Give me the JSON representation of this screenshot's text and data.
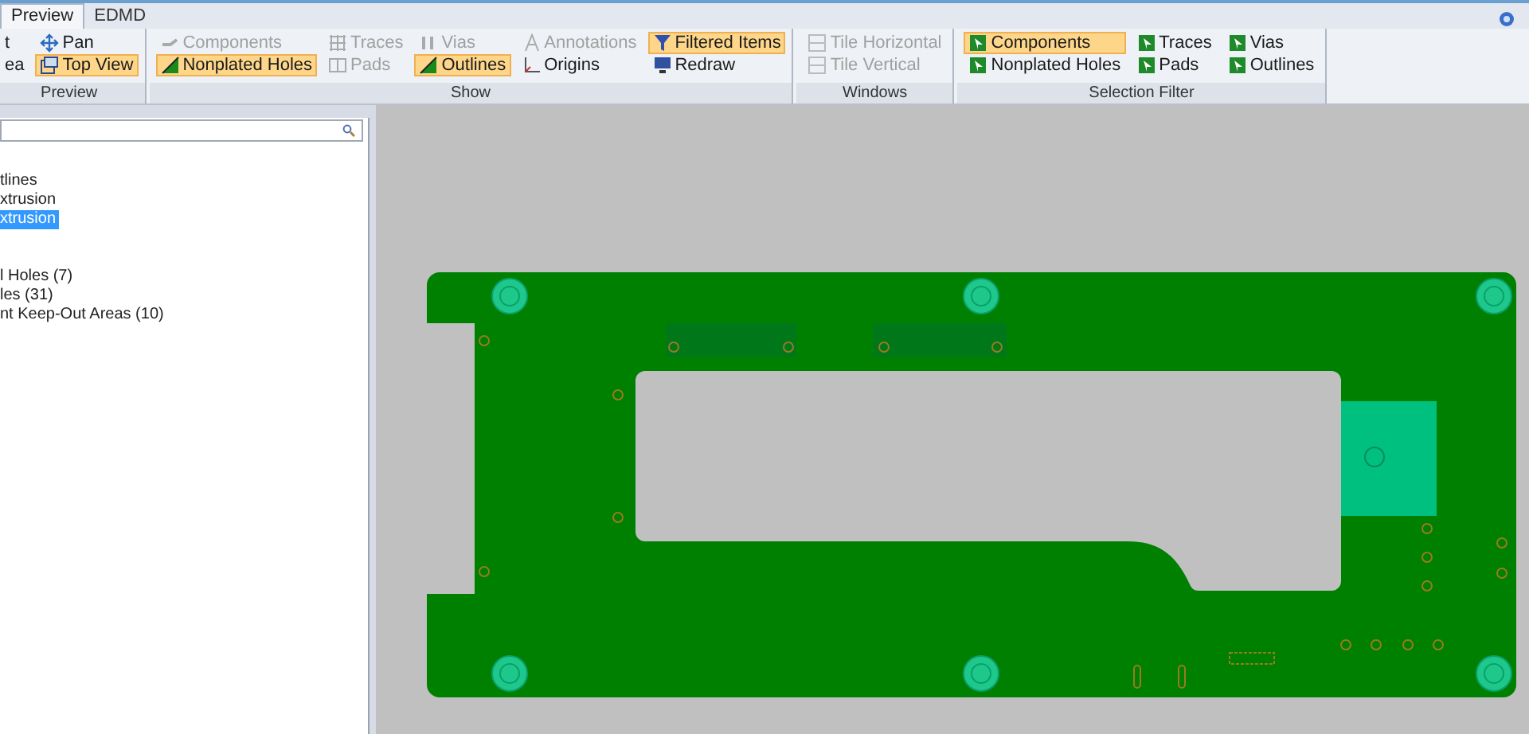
{
  "tabs": [
    {
      "label": "Preview",
      "selected": true
    },
    {
      "label": "EDMD",
      "selected": false
    }
  ],
  "ribbon": [
    {
      "label": "Preview",
      "columns": [
        [
          {
            "label": "t",
            "kind": "none",
            "selected": false,
            "disabled": false
          },
          {
            "label": "ea",
            "kind": "none",
            "selected": false,
            "disabled": false
          }
        ],
        [
          {
            "label": "Pan",
            "kind": "pan",
            "selected": false,
            "disabled": false
          },
          {
            "label": "Top View",
            "kind": "view",
            "selected": true,
            "disabled": false
          }
        ]
      ]
    },
    {
      "label": "Show",
      "columns": [
        [
          {
            "label": "Components",
            "kind": "component",
            "selected": false,
            "disabled": true
          },
          {
            "label": "Nonplated Holes",
            "kind": "check",
            "selected": true,
            "disabled": false
          }
        ],
        [
          {
            "label": "Traces",
            "kind": "trace",
            "selected": false,
            "disabled": true
          },
          {
            "label": "Pads",
            "kind": "pad",
            "selected": false,
            "disabled": true
          }
        ],
        [
          {
            "label": "Vias",
            "kind": "via",
            "selected": false,
            "disabled": true
          },
          {
            "label": "Outlines",
            "kind": "check",
            "selected": true,
            "disabled": false
          }
        ],
        [
          {
            "label": "Annotations",
            "kind": "annotation",
            "selected": false,
            "disabled": true
          },
          {
            "label": "Origins",
            "kind": "origin",
            "selected": false,
            "disabled": false
          }
        ],
        [
          {
            "label": "Filtered Items",
            "kind": "filter",
            "selected": true,
            "disabled": false
          },
          {
            "label": "Redraw",
            "kind": "redraw",
            "selected": false,
            "disabled": false
          }
        ]
      ]
    },
    {
      "label": "Windows",
      "columns": [
        [
          {
            "label": "Tile Horizontal",
            "kind": "tile",
            "selected": false,
            "disabled": true
          },
          {
            "label": "Tile Vertical",
            "kind": "tile",
            "selected": false,
            "disabled": true
          }
        ]
      ]
    },
    {
      "label": "Selection Filter",
      "columns": [
        [
          {
            "label": "Components",
            "kind": "select",
            "selected": true,
            "disabled": false
          },
          {
            "label": "Nonplated Holes",
            "kind": "select",
            "selected": false,
            "disabled": false
          }
        ],
        [
          {
            "label": "Traces",
            "kind": "select",
            "selected": false,
            "disabled": false
          },
          {
            "label": "Pads",
            "kind": "select",
            "selected": false,
            "disabled": false
          }
        ],
        [
          {
            "label": "Vias",
            "kind": "select",
            "selected": false,
            "disabled": false
          },
          {
            "label": "Outlines",
            "kind": "select",
            "selected": false,
            "disabled": false
          }
        ]
      ]
    }
  ],
  "tree": {
    "groups": [
      {
        "items": [
          {
            "label": "tlines",
            "selected": false
          },
          {
            "label": "xtrusion",
            "selected": false
          },
          {
            "label": "xtrusion",
            "selected": true
          }
        ]
      },
      {
        "items": [
          {
            "label": "l Holes (7)",
            "selected": false
          },
          {
            "label": "les (31)",
            "selected": false
          },
          {
            "label": "nt Keep-Out Areas (10)",
            "selected": false
          }
        ]
      }
    ]
  }
}
